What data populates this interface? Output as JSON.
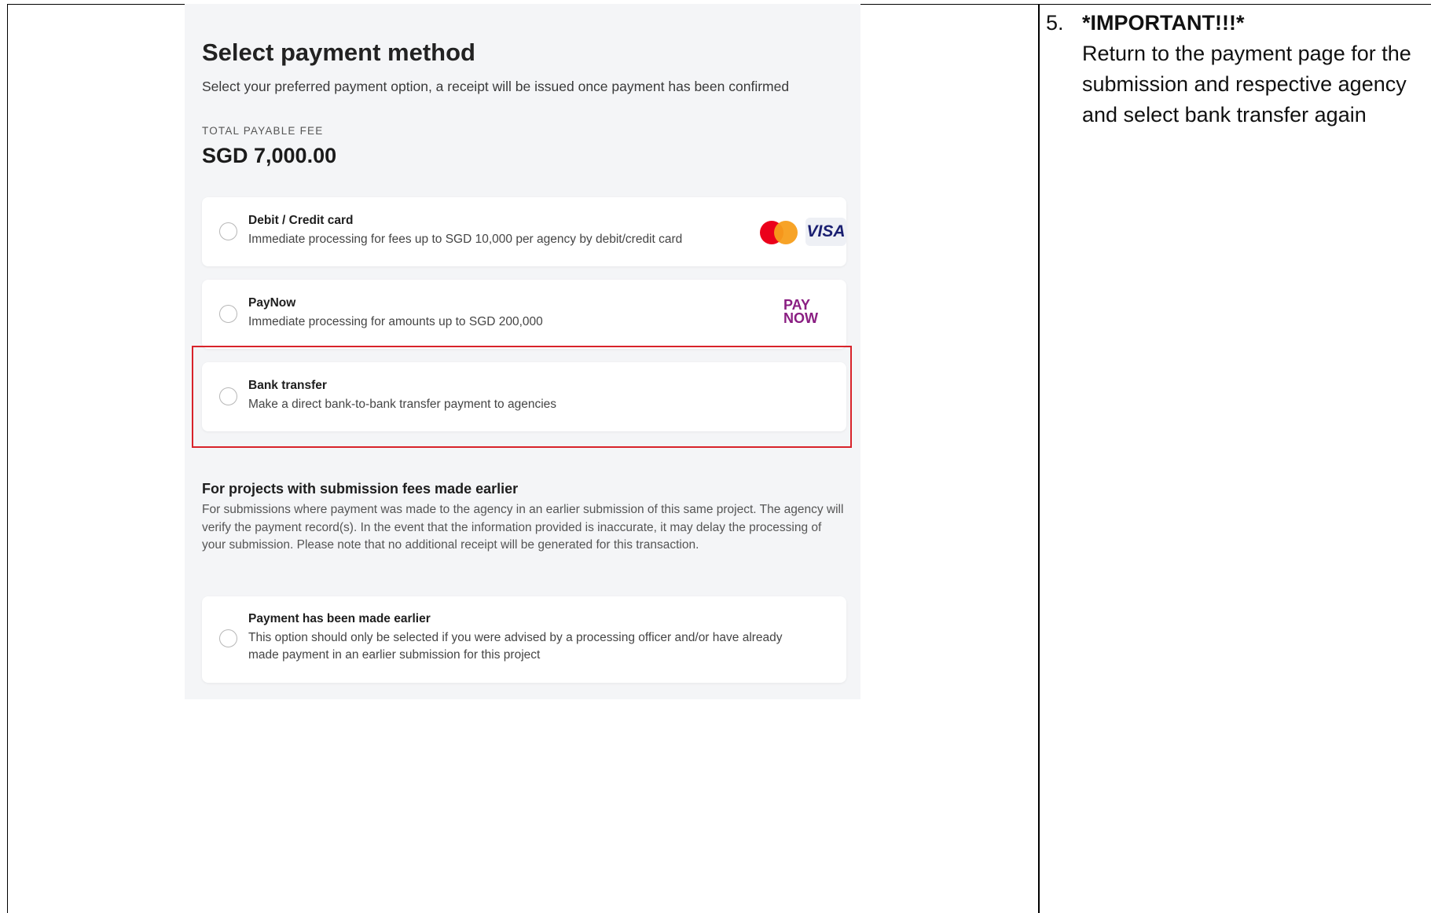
{
  "panel": {
    "title": "Select payment method",
    "subtitle": "Select your preferred payment option, a receipt will be issued once payment has been confirmed",
    "fee_label": "TOTAL PAYABLE FEE",
    "fee_amount": "SGD 7,000.00"
  },
  "options": [
    {
      "title": "Debit / Credit card",
      "desc": "Immediate processing for fees up to SGD 10,000 per agency by debit/credit card",
      "logos": [
        "mastercard",
        "VISA"
      ],
      "selected": false
    },
    {
      "title": "PayNow",
      "desc": "Immediate processing for amounts up to SGD 200,000",
      "logo_top": "PAY",
      "logo_bottom": "NOW",
      "selected": false
    },
    {
      "title": "Bank transfer",
      "desc": "Make a direct bank-to-bank transfer payment to agencies",
      "selected": false,
      "highlighted": true
    }
  ],
  "earlier_section": {
    "heading": "For projects with submission fees made earlier",
    "text": "For submissions where payment was made to the agency in an earlier submission of this same project. The agency will verify the payment record(s). In the event that the information provided is inaccurate, it may delay the processing of your submission. Please note that no additional receipt will be generated for this transaction.",
    "option": {
      "title": "Payment has been made earlier",
      "desc": "This option should only be selected if you were advised by a processing officer and/or have already made payment in an earlier submission for this project",
      "selected": false
    }
  },
  "instruction": {
    "number": "5.",
    "heading": "*IMPORTANT!!!*",
    "text": "Return to the payment page for the submission and respective agency and select bank transfer again"
  },
  "colors": {
    "highlight_border": "#d8232a",
    "panel_bg": "#f4f5f7",
    "visa_blue": "#1a1f71",
    "paynow_purple": "#8a1e82"
  }
}
